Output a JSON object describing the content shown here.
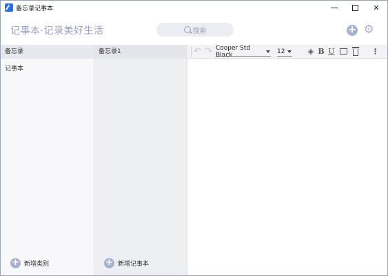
{
  "window": {
    "title": "备忘录记事本",
    "minimize_glyph": "—",
    "maximize_glyph": "☐",
    "close_glyph": "✕"
  },
  "header": {
    "brand": "记事本·记录美好生活",
    "search_placeholder": "搜索",
    "add_icon": "plus-circle-icon",
    "settings_icon": "gear-icon",
    "accent_color": "#a9b1cf"
  },
  "categories_panel": {
    "header": "备忘录",
    "items": [
      {
        "label": "记事本"
      }
    ],
    "footer_button": "新增类别"
  },
  "notes_panel": {
    "header": "备忘录1",
    "footer_button": "新增记事本"
  },
  "editor": {
    "toolbar": {
      "font_family": "Cooper Std Black",
      "font_size": "12",
      "bold_label": "B",
      "underline_label": "U",
      "more_label": "⋮"
    },
    "content": ""
  }
}
